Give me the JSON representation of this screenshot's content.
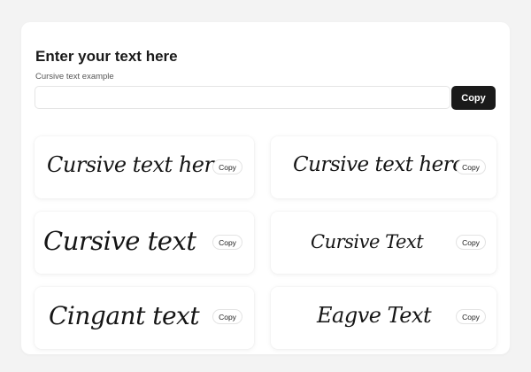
{
  "header": {
    "title": "Enter your text here",
    "subtitle": "Cursive text example"
  },
  "input": {
    "value": "",
    "placeholder": ""
  },
  "primary_copy_label": "Copy",
  "styles": [
    {
      "text": "Cursive text here",
      "copy_label": "Copy"
    },
    {
      "text": "Cursive text here",
      "copy_label": "Copy"
    },
    {
      "text": "Cursive text",
      "copy_label": "Copy"
    },
    {
      "text": "Cursive Text",
      "copy_label": "Copy"
    },
    {
      "text": "Cingant text",
      "copy_label": "Copy"
    },
    {
      "text": "Eagve Text",
      "copy_label": "Copy"
    }
  ],
  "colors": {
    "background": "#f3f3f3",
    "card": "#ffffff",
    "primary_button": "#1a1a1a",
    "text": "#1a1a1a"
  }
}
